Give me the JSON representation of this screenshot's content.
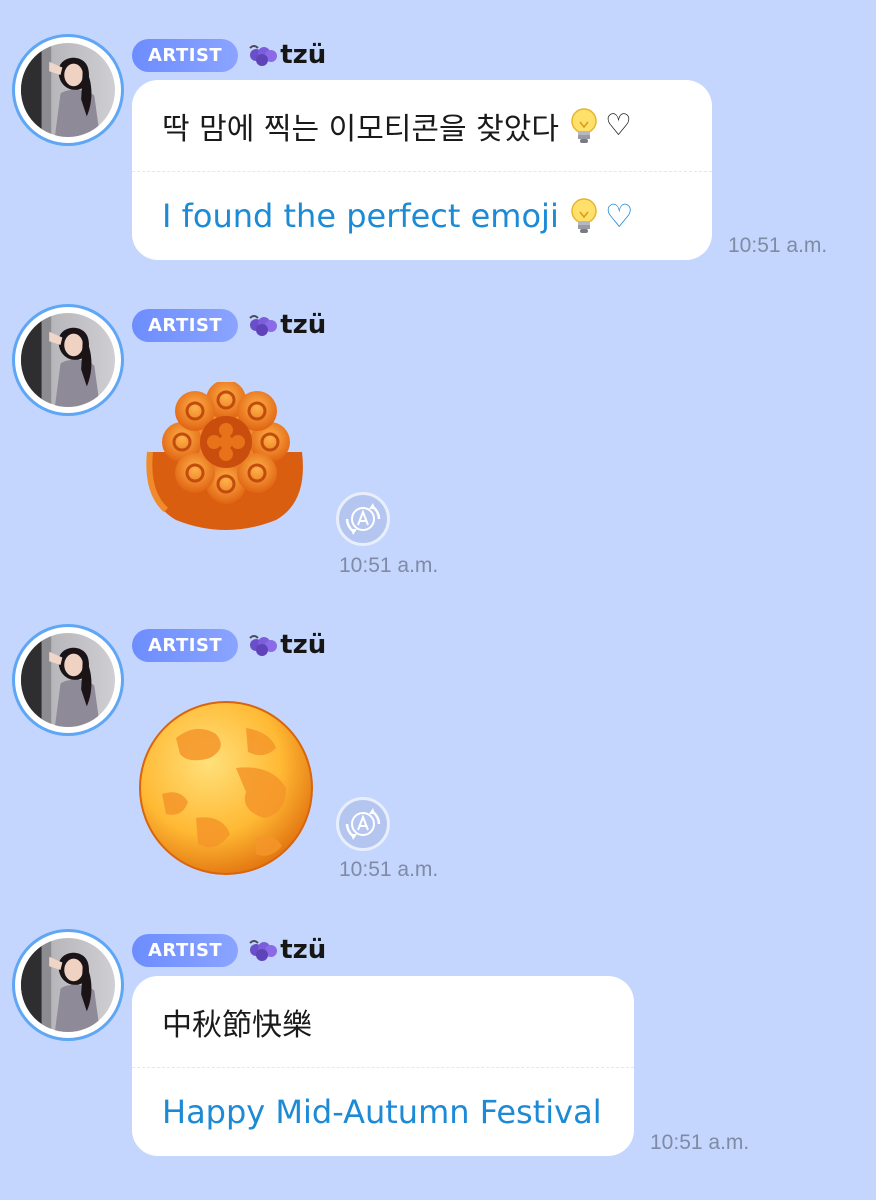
{
  "messages": [
    {
      "badge": "ARTIST",
      "sender": "tzü",
      "original": "딱 맘에 찍는 이모티콘을 찾았다",
      "original_suffix": "♡",
      "translation": "I found the perfect emoji",
      "translation_suffix": "♡",
      "time": "10:51 a.m."
    },
    {
      "badge": "ARTIST",
      "sender": "tzü",
      "sticker": "mooncake-emoji",
      "translate_icon": "translate-a-icon",
      "time": "10:51 a.m."
    },
    {
      "badge": "ARTIST",
      "sender": "tzü",
      "sticker": "full-moon-emoji",
      "translate_icon": "translate-a-icon",
      "time": "10:51 a.m."
    },
    {
      "badge": "ARTIST",
      "sender": "tzü",
      "original": "中秋節快樂",
      "translation": "Happy Mid-Autumn Festival",
      "time": "10:51 a.m."
    }
  ],
  "colors": {
    "background": "#c4d6fd",
    "badge": "#7a97ff",
    "translation_text": "#1d8ad6",
    "avatar_ring": "#5fa6f4",
    "timestamp": "#7f8ba5"
  }
}
